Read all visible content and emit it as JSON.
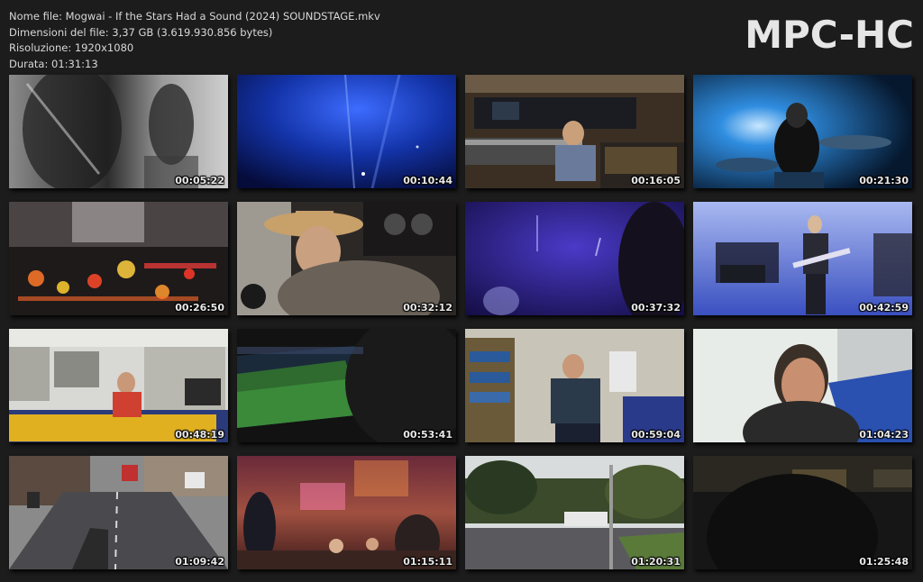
{
  "file_info": {
    "name_line": "Nome file: Mogwai - If the Stars Had a Sound (2024) SOUNDSTAGE.mkv",
    "size_line": "Dimensioni del file: 3,37 GB (3.619.930.856 bytes)",
    "resolution_line": "Risoluzione: 1920x1080",
    "duration_line": "Durata: 01:31:13"
  },
  "brand": "MPC-HC",
  "thumbnails": [
    {
      "timestamp": "00:05:22",
      "scene": "grayscale-blurred-figures"
    },
    {
      "timestamp": "00:10:44",
      "scene": "blue-stage-lights"
    },
    {
      "timestamp": "00:16:05",
      "scene": "recording-studio-mixing-desk"
    },
    {
      "timestamp": "00:21:30",
      "scene": "drummer-blue-stage"
    },
    {
      "timestamp": "00:26:50",
      "scene": "mixing-console-lights-closeup"
    },
    {
      "timestamp": "00:32:12",
      "scene": "man-cowboy-hat-studio"
    },
    {
      "timestamp": "00:37:32",
      "scene": "dark-purple-stage"
    },
    {
      "timestamp": "00:42:59",
      "scene": "guitarist-stage-blue-haze"
    },
    {
      "timestamp": "00:48:19",
      "scene": "man-sitting-art-studio"
    },
    {
      "timestamp": "00:53:41",
      "scene": "football-stadium-night"
    },
    {
      "timestamp": "00:59:04",
      "scene": "man-seated-classroom"
    },
    {
      "timestamp": "01:04:23",
      "scene": "smiling-man-selfie"
    },
    {
      "timestamp": "01:09:42",
      "scene": "city-street-cycling"
    },
    {
      "timestamp": "01:15:11",
      "scene": "crowd-concert-hall"
    },
    {
      "timestamp": "01:20:31",
      "scene": "road-with-bus"
    },
    {
      "timestamp": "01:25:48",
      "scene": "dark-video-call"
    }
  ]
}
